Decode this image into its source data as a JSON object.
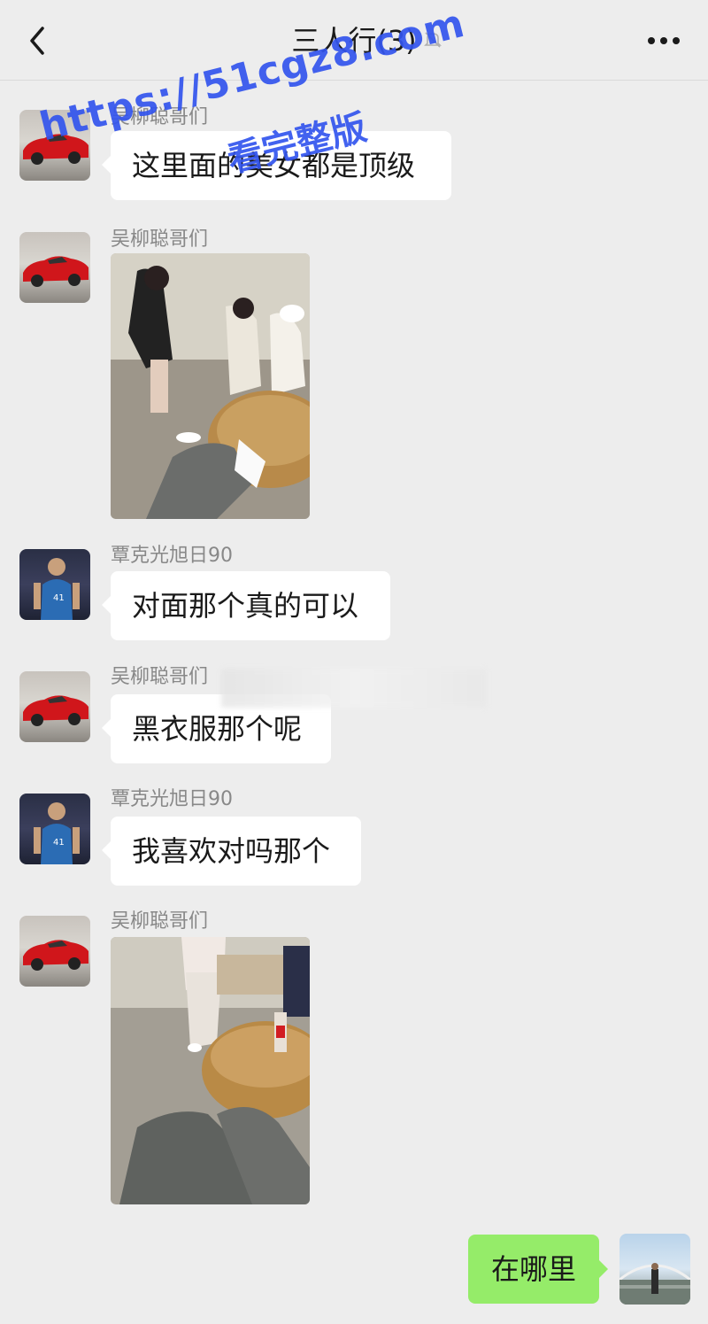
{
  "header": {
    "title": "三人行(3)",
    "back_icon": "chevron-left-icon",
    "mute_icon": "bell-mute-icon",
    "more_icon": "more-dots-icon"
  },
  "messages": [
    {
      "sender": "吴柳聪哥们",
      "text": "这里面的美女都是顶级",
      "avatar": "red-car"
    },
    {
      "sender": "吴柳聪哥们",
      "type": "image",
      "avatar": "red-car"
    },
    {
      "sender": "覃克光旭日90",
      "text": "对面那个真的可以",
      "avatar": "basketball-player"
    },
    {
      "sender": "吴柳聪哥们",
      "text": "黑衣服那个呢",
      "avatar": "red-car"
    },
    {
      "sender": "覃克光旭日90",
      "text": "我喜欢对吗那个",
      "avatar": "basketball-player"
    },
    {
      "sender": "吴柳聪哥们",
      "type": "image",
      "avatar": "red-car"
    }
  ],
  "self_message": {
    "text": "在哪里",
    "avatar": "river-bridge"
  },
  "watermark": {
    "line1": "https://51cgz8.com",
    "line2": "看完整版"
  },
  "colors": {
    "background": "#ededed",
    "bubble_incoming": "#ffffff",
    "bubble_outgoing": "#95ec69",
    "watermark": "#3355ee"
  }
}
